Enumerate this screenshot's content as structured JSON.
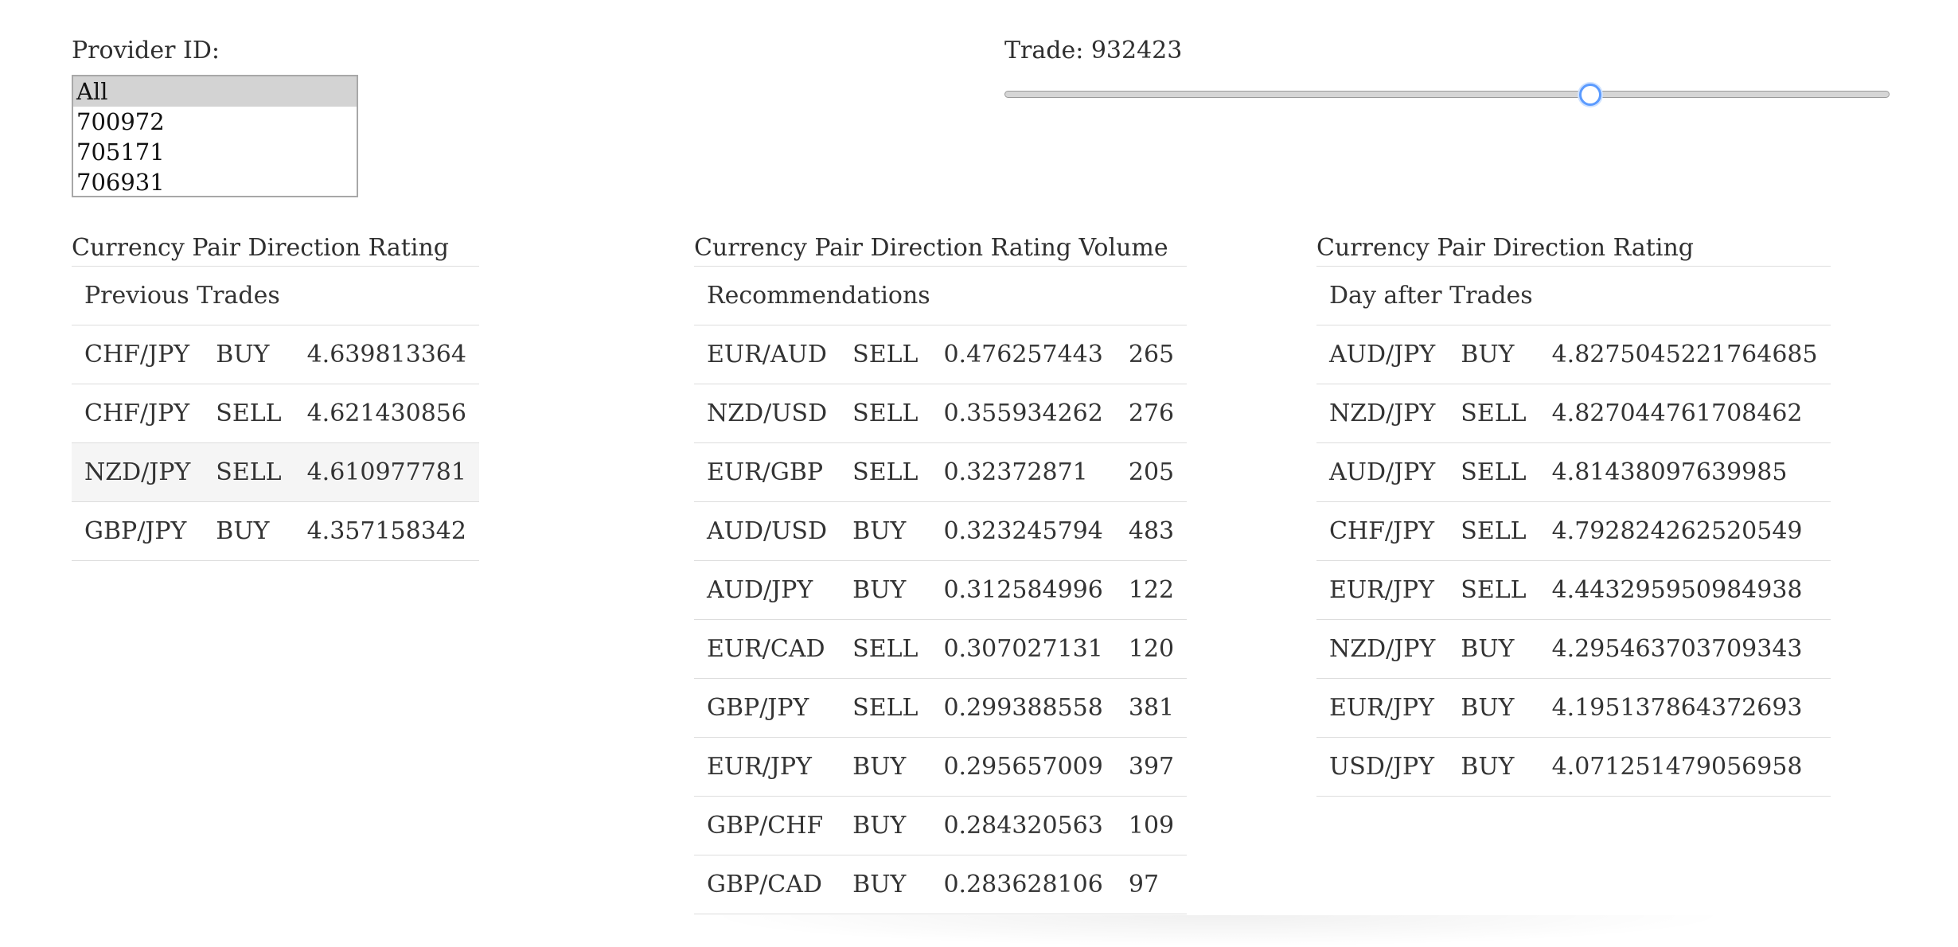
{
  "provider": {
    "label": "Provider ID:",
    "options": [
      "All",
      "700972",
      "705171",
      "706931"
    ],
    "selected": "All"
  },
  "trade": {
    "label": "Trade: 932423",
    "slider_position_fraction": 0.662
  },
  "previous": {
    "title": "Currency Pair Direction Rating",
    "header": "Previous Trades",
    "rows": [
      {
        "pair": "CHF/JPY",
        "dir": "BUY",
        "rating": "4.639813364"
      },
      {
        "pair": "CHF/JPY",
        "dir": "SELL",
        "rating": "4.621430856"
      },
      {
        "pair": "NZD/JPY",
        "dir": "SELL",
        "rating": "4.610977781"
      },
      {
        "pair": "GBP/JPY",
        "dir": "BUY",
        "rating": "4.357158342"
      }
    ],
    "highlighted_row": 2
  },
  "recommendations": {
    "title": "Currency Pair Direction Rating Volume",
    "header": "Recommendations",
    "rows": [
      {
        "pair": "EUR/AUD",
        "dir": "SELL",
        "rating": "0.476257443",
        "volume": "265"
      },
      {
        "pair": "NZD/USD",
        "dir": "SELL",
        "rating": "0.355934262",
        "volume": "276"
      },
      {
        "pair": "EUR/GBP",
        "dir": "SELL",
        "rating": "0.32372871",
        "volume": "205"
      },
      {
        "pair": "AUD/USD",
        "dir": "BUY",
        "rating": "0.323245794",
        "volume": "483"
      },
      {
        "pair": "AUD/JPY",
        "dir": "BUY",
        "rating": "0.312584996",
        "volume": "122"
      },
      {
        "pair": "EUR/CAD",
        "dir": "SELL",
        "rating": "0.307027131",
        "volume": "120"
      },
      {
        "pair": "GBP/JPY",
        "dir": "SELL",
        "rating": "0.299388558",
        "volume": "381"
      },
      {
        "pair": "EUR/JPY",
        "dir": "BUY",
        "rating": "0.295657009",
        "volume": "397"
      },
      {
        "pair": "GBP/CHF",
        "dir": "BUY",
        "rating": "0.284320563",
        "volume": "109"
      },
      {
        "pair": "GBP/CAD",
        "dir": "BUY",
        "rating": "0.283628106",
        "volume": "97"
      }
    ]
  },
  "day_after": {
    "title": "Currency Pair Direction Rating",
    "header": "Day after Trades",
    "rows": [
      {
        "pair": "AUD/JPY",
        "dir": "BUY",
        "rating": "4.8275045221764685"
      },
      {
        "pair": "NZD/JPY",
        "dir": "SELL",
        "rating": "4.827044761708462"
      },
      {
        "pair": "AUD/JPY",
        "dir": "SELL",
        "rating": "4.81438097639985"
      },
      {
        "pair": "CHF/JPY",
        "dir": "SELL",
        "rating": "4.792824262520549"
      },
      {
        "pair": "EUR/JPY",
        "dir": "SELL",
        "rating": "4.443295950984938"
      },
      {
        "pair": "NZD/JPY",
        "dir": "BUY",
        "rating": "4.295463703709343"
      },
      {
        "pair": "EUR/JPY",
        "dir": "BUY",
        "rating": "4.195137864372693"
      },
      {
        "pair": "USD/JPY",
        "dir": "BUY",
        "rating": "4.071251479056958"
      }
    ]
  },
  "colors": {
    "selected_option_bg": "#d3d3d3",
    "highlight_row_bg": "#f5f5f5",
    "slider_thumb_border": "#5b9bff",
    "row_divider": "#dddddd"
  }
}
